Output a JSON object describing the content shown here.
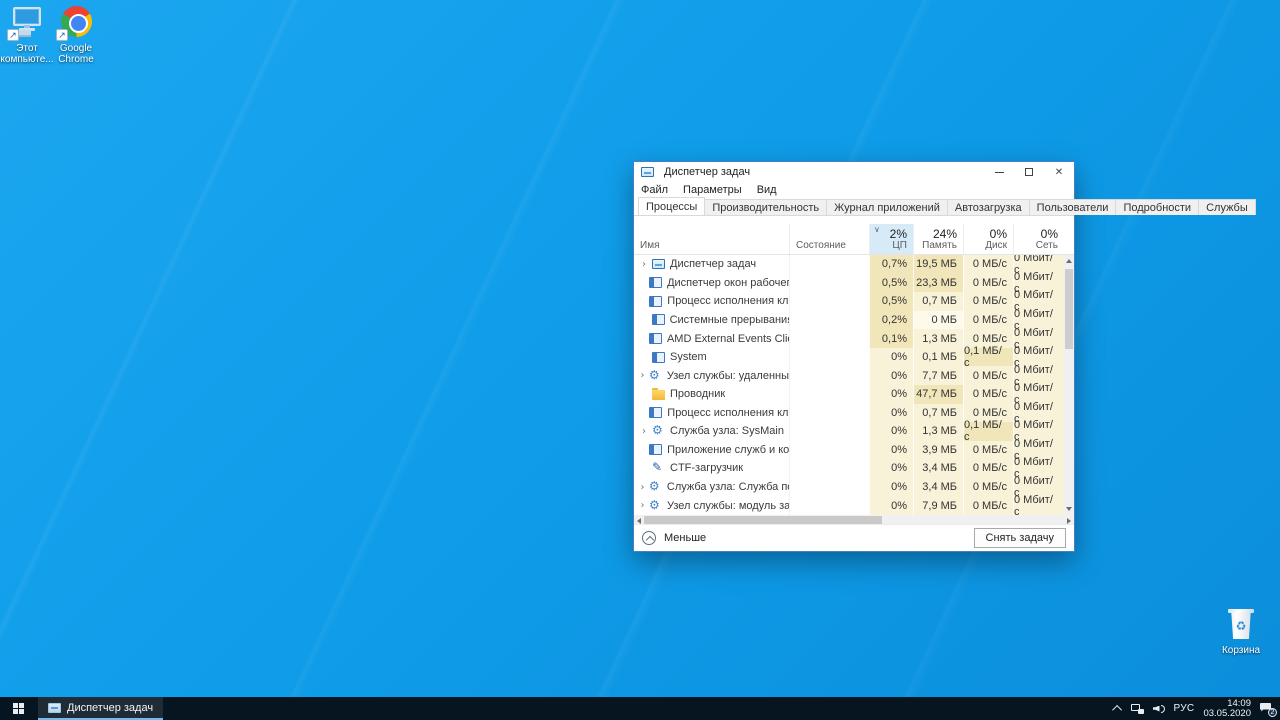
{
  "desktop": {
    "icons": [
      {
        "id": "this-pc",
        "label": "Этот компьюте..."
      },
      {
        "id": "chrome",
        "label": "Google Chrome"
      },
      {
        "id": "recycle-bin",
        "label": "Корзина"
      }
    ]
  },
  "window": {
    "title": "Диспетчер задач",
    "menus": [
      "Файл",
      "Параметры",
      "Вид"
    ],
    "tabs": [
      {
        "label": "Процессы",
        "active": true
      },
      {
        "label": "Производительность",
        "active": false
      },
      {
        "label": "Журнал приложений",
        "active": false
      },
      {
        "label": "Автозагрузка",
        "active": false
      },
      {
        "label": "Пользователи",
        "active": false
      },
      {
        "label": "Подробности",
        "active": false
      },
      {
        "label": "Службы",
        "active": false
      }
    ],
    "columns": {
      "name": "Имя",
      "status": "Состояние",
      "cpu": {
        "pct": "2%",
        "label": "ЦП"
      },
      "memory": {
        "pct": "24%",
        "label": "Память"
      },
      "disk": {
        "pct": "0%",
        "label": "Диск"
      },
      "network": {
        "pct": "0%",
        "label": "Сеть"
      }
    },
    "heat_colors": [
      "#fdfae9",
      "#f8f2d8",
      "#f1e6ba"
    ],
    "processes": [
      {
        "name": "Диспетчер задач",
        "icon": "taskmgr",
        "expand": true,
        "status": "",
        "cpu": "0,7%",
        "mem": "19,5 МБ",
        "disk": "0 МБ/с",
        "net": "0 Мбит/с",
        "heat": [
          2,
          2,
          1,
          1
        ]
      },
      {
        "name": "Диспетчер окон рабочего стола",
        "icon": "window",
        "expand": false,
        "status": "",
        "cpu": "0,5%",
        "mem": "23,3 МБ",
        "disk": "0 МБ/с",
        "net": "0 Мбит/с",
        "heat": [
          2,
          2,
          1,
          1
        ]
      },
      {
        "name": "Процесс исполнения клиент-...",
        "icon": "window",
        "expand": false,
        "status": "",
        "cpu": "0,5%",
        "mem": "0,7 МБ",
        "disk": "0 МБ/с",
        "net": "0 Мбит/с",
        "heat": [
          2,
          1,
          1,
          1
        ]
      },
      {
        "name": "Системные прерывания",
        "icon": "window",
        "expand": false,
        "status": "",
        "cpu": "0,2%",
        "mem": "0 МБ",
        "disk": "0 МБ/с",
        "net": "0 Мбит/с",
        "heat": [
          2,
          0,
          1,
          1
        ]
      },
      {
        "name": "AMD External Events Client Mo...",
        "icon": "window",
        "expand": false,
        "status": "",
        "cpu": "0,1%",
        "mem": "1,3 МБ",
        "disk": "0 МБ/с",
        "net": "0 Мбит/с",
        "heat": [
          2,
          1,
          1,
          1
        ]
      },
      {
        "name": "System",
        "icon": "window",
        "expand": false,
        "status": "",
        "cpu": "0%",
        "mem": "0,1 МБ",
        "disk": "0,1 МБ/с",
        "net": "0 Мбит/с",
        "heat": [
          1,
          1,
          2,
          1
        ]
      },
      {
        "name": "Узел службы: удаленный вызо...",
        "icon": "gear",
        "expand": true,
        "status": "",
        "cpu": "0%",
        "mem": "7,7 МБ",
        "disk": "0 МБ/с",
        "net": "0 Мбит/с",
        "heat": [
          1,
          1,
          1,
          1
        ]
      },
      {
        "name": "Проводник",
        "icon": "folder",
        "expand": false,
        "status": "",
        "cpu": "0%",
        "mem": "47,7 МБ",
        "disk": "0 МБ/с",
        "net": "0 Мбит/с",
        "heat": [
          1,
          2,
          1,
          1
        ]
      },
      {
        "name": "Процесс исполнения клиент-...",
        "icon": "window",
        "expand": false,
        "status": "",
        "cpu": "0%",
        "mem": "0,7 МБ",
        "disk": "0 МБ/с",
        "net": "0 Мбит/с",
        "heat": [
          1,
          1,
          1,
          1
        ]
      },
      {
        "name": "Служба узла: SysMain",
        "icon": "gear",
        "expand": true,
        "status": "",
        "cpu": "0%",
        "mem": "1,3 МБ",
        "disk": "0,1 МБ/с",
        "net": "0 Мбит/с",
        "heat": [
          1,
          1,
          2,
          1
        ]
      },
      {
        "name": "Приложение служб и контрол...",
        "icon": "window",
        "expand": false,
        "status": "",
        "cpu": "0%",
        "mem": "3,9 МБ",
        "disk": "0 МБ/с",
        "net": "0 Мбит/с",
        "heat": [
          1,
          1,
          1,
          1
        ]
      },
      {
        "name": "CTF-загрузчик",
        "icon": "pen",
        "expand": false,
        "status": "",
        "cpu": "0%",
        "mem": "3,4 МБ",
        "disk": "0 МБ/с",
        "net": "0 Мбит/с",
        "heat": [
          1,
          1,
          1,
          1
        ]
      },
      {
        "name": "Служба узла: Служба пользов...",
        "icon": "gear",
        "expand": true,
        "status": "",
        "cpu": "0%",
        "mem": "3,4 МБ",
        "disk": "0 МБ/с",
        "net": "0 Мбит/с",
        "heat": [
          1,
          1,
          1,
          1
        ]
      },
      {
        "name": "Узел службы: модуль запуска ...",
        "icon": "gear",
        "expand": true,
        "status": "",
        "cpu": "0%",
        "mem": "7,9 МБ",
        "disk": "0 МБ/с",
        "net": "0 Мбит/с",
        "heat": [
          1,
          1,
          1,
          1
        ]
      }
    ],
    "footer": {
      "less_label": "Меньше",
      "end_task_label": "Снять задачу"
    }
  },
  "taskbar": {
    "task_button_label": "Диспетчер задач",
    "language": "РУС",
    "time": "14:09",
    "date": "03.05.2020",
    "notification_badge": "2"
  }
}
